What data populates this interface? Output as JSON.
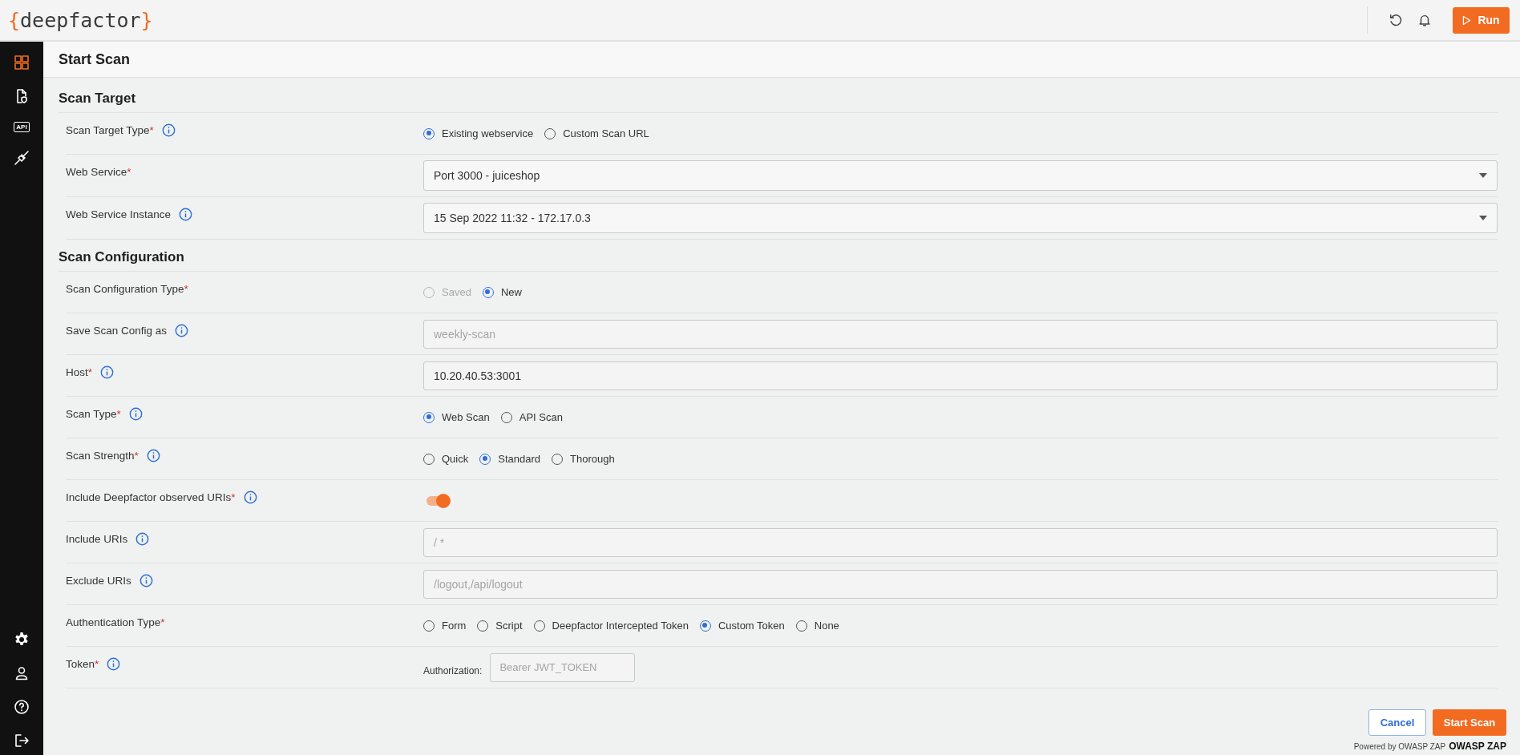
{
  "logo": {
    "open": "{",
    "name": "deepfactor",
    "close": "}"
  },
  "header": {
    "actions": [
      {
        "kind": "refresh"
      },
      {
        "kind": "bell"
      }
    ],
    "run_button": "Run"
  },
  "sidebar": {
    "top": [
      {
        "kind": "grid",
        "selected": true
      },
      {
        "kind": "document",
        "selected": false
      },
      {
        "kind": "api",
        "label": "API",
        "selected": false
      },
      {
        "kind": "plug",
        "selected": false
      }
    ],
    "bottom": [
      {
        "kind": "gear",
        "selected": false
      },
      {
        "kind": "user",
        "selected": false
      },
      {
        "kind": "help",
        "selected": false
      },
      {
        "kind": "logout",
        "selected": false
      }
    ]
  },
  "page_title": "Start Scan",
  "sections": [
    {
      "title": "Scan Target",
      "rows": [
        {
          "label": "Scan Target Type",
          "required": "*",
          "info": true,
          "kind": "radio",
          "options": [
            {
              "label": "Existing webservice",
              "selected": true,
              "disabled": false
            },
            {
              "label": "Custom Scan URL",
              "selected": false,
              "disabled": false
            }
          ]
        },
        {
          "label": "Web Service",
          "required": "*",
          "info": false,
          "kind": "select",
          "value": "Port 3000 - juiceshop"
        },
        {
          "label": "Web Service Instance",
          "info": true,
          "kind": "select",
          "value": "15 Sep 2022 11:32 - 172.17.0.3"
        }
      ]
    },
    {
      "title": "Scan Configuration",
      "rows": [
        {
          "label": "Scan Configuration Type",
          "required": "*",
          "info": false,
          "kind": "radio",
          "options": [
            {
              "label": "Saved",
              "selected": false,
              "disabled": true
            },
            {
              "label": "New",
              "selected": true,
              "disabled": false
            }
          ]
        },
        {
          "label": "Save Scan Config as",
          "info": true,
          "kind": "text",
          "placeholder": "weekly-scan"
        },
        {
          "label": "Host",
          "required": "*",
          "info": true,
          "kind": "text",
          "value": "10.20.40.53:3001"
        },
        {
          "label": "Scan Type",
          "required": "*",
          "info": true,
          "kind": "radio",
          "options": [
            {
              "label": "Web Scan",
              "selected": true,
              "disabled": false
            },
            {
              "label": "API Scan",
              "selected": false,
              "disabled": false
            }
          ]
        },
        {
          "label": "Scan Strength",
          "required": "*",
          "info": true,
          "kind": "radio",
          "options": [
            {
              "label": "Quick",
              "selected": false,
              "disabled": false
            },
            {
              "label": "Standard",
              "selected": true,
              "disabled": false
            },
            {
              "label": "Thorough",
              "selected": false,
              "disabled": false
            }
          ]
        },
        {
          "label": "Include Deepfactor observed URIs",
          "required": "*",
          "info": true,
          "kind": "toggle",
          "on": true
        },
        {
          "label": "Include URIs",
          "info": true,
          "kind": "text",
          "placeholder": "/ *"
        },
        {
          "label": "Exclude URIs",
          "info": true,
          "kind": "text",
          "placeholder": "/logout,/api/logout"
        },
        {
          "label": "Authentication Type",
          "required": "*",
          "info": false,
          "kind": "radio",
          "options": [
            {
              "label": "Form",
              "selected": false,
              "disabled": false
            },
            {
              "label": "Script",
              "selected": false,
              "disabled": false
            },
            {
              "label": "Deepfactor Intercepted Token",
              "selected": false,
              "disabled": false
            },
            {
              "label": "Custom Token",
              "selected": true,
              "disabled": false
            },
            {
              "label": "None",
              "selected": false,
              "disabled": false
            }
          ]
        },
        {
          "label": "Token",
          "required": "*",
          "info": true,
          "kind": "token",
          "prefix": "Authorization:",
          "placeholder": "Bearer JWT_TOKEN"
        }
      ]
    }
  ],
  "footer": {
    "cancel": "Cancel",
    "submit": "Start Scan",
    "powered_by": "Powered by OWASP ZAP",
    "brand": "OWASP ZAP"
  }
}
